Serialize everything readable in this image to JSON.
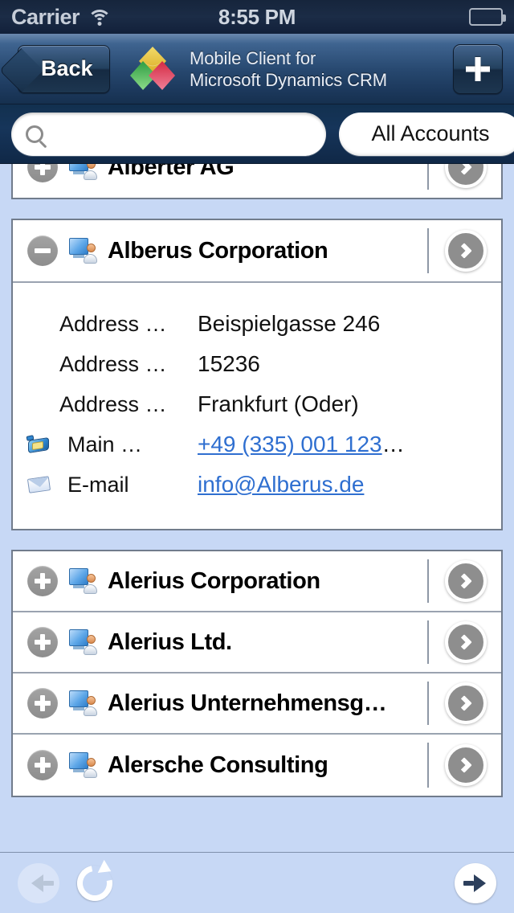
{
  "status_bar": {
    "carrier": "Carrier",
    "time": "8:55 PM",
    "wifi_icon": "wifi-icon",
    "battery_icon": "battery-icon"
  },
  "nav_bar": {
    "back_label": "Back",
    "title_line1": "Mobile Client for",
    "title_line2": "Microsoft Dynamics CRM",
    "logo_icon": "dynamics-logo-icon",
    "add_label": "+",
    "logo_colors": {
      "top_diamond": "#e8c53a",
      "left_diamond": "#3fa94a",
      "right_diamond": "#cf3049"
    }
  },
  "search": {
    "value": "",
    "placeholder": "",
    "icon": "search-icon",
    "view_filter_label": "All Accounts"
  },
  "list": {
    "clipped_row": {
      "name": "Alberter AG",
      "toggle": "plus",
      "icon": "account-icon",
      "chevron": "chevron-right-icon"
    },
    "expanded_account": {
      "name": "Alberus Corporation",
      "toggle": "minus",
      "icon": "account-icon",
      "chevron": "chevron-right-icon",
      "details": [
        {
          "label": "Address …",
          "value": "Beispielgasse 246",
          "icon": null,
          "link": false
        },
        {
          "label": "Address …",
          "value": "15236",
          "icon": null,
          "link": false
        },
        {
          "label": "Address …",
          "value": "Frankfurt (Oder)",
          "icon": null,
          "link": false
        },
        {
          "label": "Main …",
          "value": "+49 (335) 001 123",
          "trailing": "…",
          "icon": "phone-icon",
          "link": true
        },
        {
          "label": "E-mail",
          "value": "info@Alberus.de",
          "trailing": "",
          "icon": "email-icon",
          "link": true
        }
      ]
    },
    "rows": [
      {
        "name": "Alerius Corporation",
        "toggle": "plus",
        "icon": "account-icon",
        "chevron": "chevron-right-icon"
      },
      {
        "name": "Alerius Ltd.",
        "toggle": "plus",
        "icon": "account-icon",
        "chevron": "chevron-right-icon"
      },
      {
        "name": "Alerius Unternehmensg…",
        "toggle": "plus",
        "icon": "account-icon",
        "chevron": "chevron-right-icon"
      },
      {
        "name": "Alersche Consulting",
        "toggle": "plus",
        "icon": "account-icon",
        "chevron": "chevron-right-icon"
      }
    ]
  },
  "toolbar": {
    "previous_icon": "arrow-left-icon",
    "previous_enabled": false,
    "refresh_icon": "refresh-icon",
    "next_icon": "arrow-right-icon",
    "next_enabled": true
  },
  "colors": {
    "page_background": "#c7d8f5",
    "nav_dark": "#16304f",
    "link": "#2f6fd0",
    "card_border": "#717c8c",
    "toggle_gray": "#8d8d8d"
  }
}
